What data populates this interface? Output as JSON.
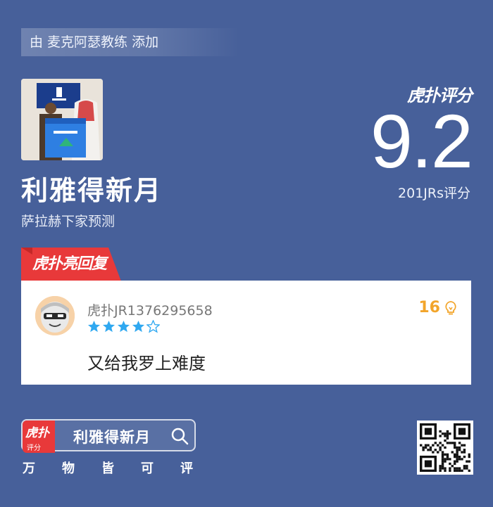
{
  "added_by": "由 麦克阿瑟教练 添加",
  "item": {
    "title": "利雅得新月",
    "subtitle": "萨拉赫下家预测",
    "image": "photo of player holding blue jersey next to man in white robe"
  },
  "rating": {
    "brand": "虎扑评分",
    "score": "9.2",
    "count_label": "201JRs评分"
  },
  "hot_reply": {
    "badge": "虎扑亮回复",
    "username": "虎扑JR1376295658",
    "stars": 4,
    "max_stars": 5,
    "likes": "16",
    "comment": "又给我罗上难度"
  },
  "footer": {
    "app_icon_top": "虎扑",
    "app_icon_sub": "评分",
    "search_text": "利雅得新月",
    "slogan": [
      "万",
      "物",
      "皆",
      "可",
      "评"
    ]
  },
  "colors": {
    "background": "#47609a",
    "badge_red": "#e8393a",
    "star_blue": "#2fa8f0",
    "likes_orange": "#f2a52b"
  }
}
